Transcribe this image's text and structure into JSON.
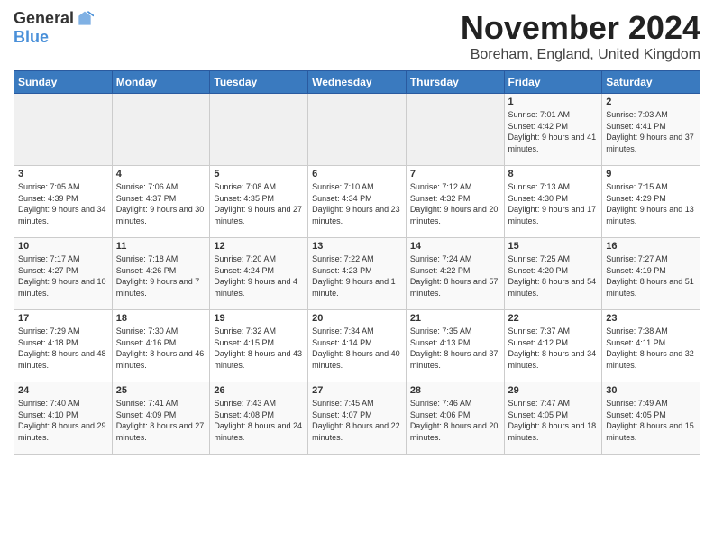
{
  "header": {
    "logo_general": "General",
    "logo_blue": "Blue",
    "month": "November 2024",
    "location": "Boreham, England, United Kingdom"
  },
  "days_of_week": [
    "Sunday",
    "Monday",
    "Tuesday",
    "Wednesday",
    "Thursday",
    "Friday",
    "Saturday"
  ],
  "weeks": [
    [
      {
        "day": "",
        "info": ""
      },
      {
        "day": "",
        "info": ""
      },
      {
        "day": "",
        "info": ""
      },
      {
        "day": "",
        "info": ""
      },
      {
        "day": "",
        "info": ""
      },
      {
        "day": "1",
        "info": "Sunrise: 7:01 AM\nSunset: 4:42 PM\nDaylight: 9 hours and 41 minutes."
      },
      {
        "day": "2",
        "info": "Sunrise: 7:03 AM\nSunset: 4:41 PM\nDaylight: 9 hours and 37 minutes."
      }
    ],
    [
      {
        "day": "3",
        "info": "Sunrise: 7:05 AM\nSunset: 4:39 PM\nDaylight: 9 hours and 34 minutes."
      },
      {
        "day": "4",
        "info": "Sunrise: 7:06 AM\nSunset: 4:37 PM\nDaylight: 9 hours and 30 minutes."
      },
      {
        "day": "5",
        "info": "Sunrise: 7:08 AM\nSunset: 4:35 PM\nDaylight: 9 hours and 27 minutes."
      },
      {
        "day": "6",
        "info": "Sunrise: 7:10 AM\nSunset: 4:34 PM\nDaylight: 9 hours and 23 minutes."
      },
      {
        "day": "7",
        "info": "Sunrise: 7:12 AM\nSunset: 4:32 PM\nDaylight: 9 hours and 20 minutes."
      },
      {
        "day": "8",
        "info": "Sunrise: 7:13 AM\nSunset: 4:30 PM\nDaylight: 9 hours and 17 minutes."
      },
      {
        "day": "9",
        "info": "Sunrise: 7:15 AM\nSunset: 4:29 PM\nDaylight: 9 hours and 13 minutes."
      }
    ],
    [
      {
        "day": "10",
        "info": "Sunrise: 7:17 AM\nSunset: 4:27 PM\nDaylight: 9 hours and 10 minutes."
      },
      {
        "day": "11",
        "info": "Sunrise: 7:18 AM\nSunset: 4:26 PM\nDaylight: 9 hours and 7 minutes."
      },
      {
        "day": "12",
        "info": "Sunrise: 7:20 AM\nSunset: 4:24 PM\nDaylight: 9 hours and 4 minutes."
      },
      {
        "day": "13",
        "info": "Sunrise: 7:22 AM\nSunset: 4:23 PM\nDaylight: 9 hours and 1 minute."
      },
      {
        "day": "14",
        "info": "Sunrise: 7:24 AM\nSunset: 4:22 PM\nDaylight: 8 hours and 57 minutes."
      },
      {
        "day": "15",
        "info": "Sunrise: 7:25 AM\nSunset: 4:20 PM\nDaylight: 8 hours and 54 minutes."
      },
      {
        "day": "16",
        "info": "Sunrise: 7:27 AM\nSunset: 4:19 PM\nDaylight: 8 hours and 51 minutes."
      }
    ],
    [
      {
        "day": "17",
        "info": "Sunrise: 7:29 AM\nSunset: 4:18 PM\nDaylight: 8 hours and 48 minutes."
      },
      {
        "day": "18",
        "info": "Sunrise: 7:30 AM\nSunset: 4:16 PM\nDaylight: 8 hours and 46 minutes."
      },
      {
        "day": "19",
        "info": "Sunrise: 7:32 AM\nSunset: 4:15 PM\nDaylight: 8 hours and 43 minutes."
      },
      {
        "day": "20",
        "info": "Sunrise: 7:34 AM\nSunset: 4:14 PM\nDaylight: 8 hours and 40 minutes."
      },
      {
        "day": "21",
        "info": "Sunrise: 7:35 AM\nSunset: 4:13 PM\nDaylight: 8 hours and 37 minutes."
      },
      {
        "day": "22",
        "info": "Sunrise: 7:37 AM\nSunset: 4:12 PM\nDaylight: 8 hours and 34 minutes."
      },
      {
        "day": "23",
        "info": "Sunrise: 7:38 AM\nSunset: 4:11 PM\nDaylight: 8 hours and 32 minutes."
      }
    ],
    [
      {
        "day": "24",
        "info": "Sunrise: 7:40 AM\nSunset: 4:10 PM\nDaylight: 8 hours and 29 minutes."
      },
      {
        "day": "25",
        "info": "Sunrise: 7:41 AM\nSunset: 4:09 PM\nDaylight: 8 hours and 27 minutes."
      },
      {
        "day": "26",
        "info": "Sunrise: 7:43 AM\nSunset: 4:08 PM\nDaylight: 8 hours and 24 minutes."
      },
      {
        "day": "27",
        "info": "Sunrise: 7:45 AM\nSunset: 4:07 PM\nDaylight: 8 hours and 22 minutes."
      },
      {
        "day": "28",
        "info": "Sunrise: 7:46 AM\nSunset: 4:06 PM\nDaylight: 8 hours and 20 minutes."
      },
      {
        "day": "29",
        "info": "Sunrise: 7:47 AM\nSunset: 4:05 PM\nDaylight: 8 hours and 18 minutes."
      },
      {
        "day": "30",
        "info": "Sunrise: 7:49 AM\nSunset: 4:05 PM\nDaylight: 8 hours and 15 minutes."
      }
    ]
  ]
}
